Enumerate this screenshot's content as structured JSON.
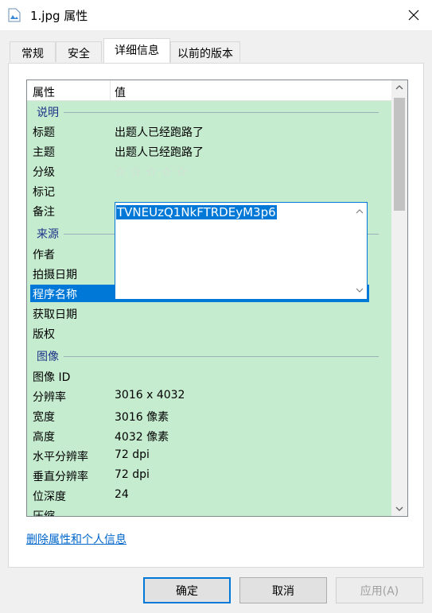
{
  "window": {
    "title": "1.jpg 属性"
  },
  "tabs": [
    {
      "label": "常规"
    },
    {
      "label": "安全"
    },
    {
      "label": "详细信息"
    },
    {
      "label": "以前的版本"
    }
  ],
  "list": {
    "headers": {
      "property": "属性",
      "value": "值"
    },
    "groups": {
      "description": "说明",
      "origin": "来源",
      "image": "图像"
    },
    "rows": {
      "title": {
        "label": "标题",
        "value": "出题人已经跑路了"
      },
      "subject": {
        "label": "主题",
        "value": "出题人已经跑路了"
      },
      "rating": {
        "label": "分级",
        "stars": 0,
        "max_stars": 5
      },
      "tags": {
        "label": "标记"
      },
      "comments": {
        "label": "备注",
        "value": "TVNEUzQ1NkFTRDEyM3p6"
      },
      "author": {
        "label": "作者"
      },
      "date_taken": {
        "label": "拍摄日期"
      },
      "program": {
        "label": "程序名称"
      },
      "date_acquired": {
        "label": "获取日期"
      },
      "copyright": {
        "label": "版权"
      },
      "image_id": {
        "label": "图像 ID"
      },
      "dimensions": {
        "label": "分辨率",
        "value": "3016 x 4032"
      },
      "width": {
        "label": "宽度",
        "value": "3016 像素"
      },
      "height": {
        "label": "高度",
        "value": "4032 像素"
      },
      "h_res": {
        "label": "水平分辨率",
        "value": "72 dpi"
      },
      "v_res": {
        "label": "垂直分辨率",
        "value": "72 dpi"
      },
      "bit_depth": {
        "label": "位深度",
        "value": "24"
      },
      "compression": {
        "label": "压缩"
      }
    }
  },
  "remove_link": "删除属性和个人信息",
  "buttons": {
    "ok": "确定",
    "cancel": "取消",
    "apply": "应用(A)"
  },
  "colors": {
    "list_bg": "#c6ecd0",
    "selection": "#0078d7",
    "link": "#0066cc"
  }
}
